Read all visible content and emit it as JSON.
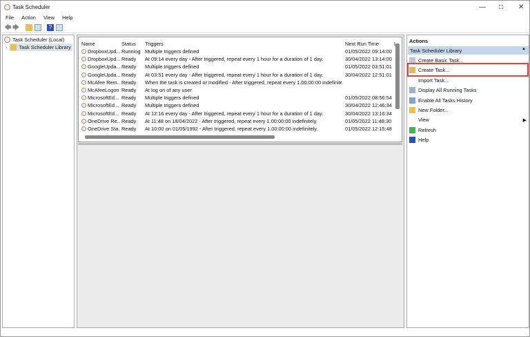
{
  "window": {
    "title": "Task Scheduler"
  },
  "menu": [
    "File",
    "Action",
    "View",
    "Help"
  ],
  "tree": {
    "root": "Task Scheduler (Local)",
    "child": "Task Scheduler Library"
  },
  "table": {
    "columns": [
      "Name",
      "Status",
      "Triggers",
      "Next Run Time",
      "L"
    ],
    "rows": [
      {
        "name": "DropboxUpd...",
        "status": "Running",
        "triggers": "Multiple triggers defined",
        "next": "01/05/2022 09:14:00"
      },
      {
        "name": "DropboxUpd...",
        "status": "Ready",
        "triggers": "At 09:14 every day - After triggered, repeat every 1 hour for a duration of 1 day.",
        "next": "30/04/2022 13:14:00"
      },
      {
        "name": "GoogleUpda...",
        "status": "Ready",
        "triggers": "Multiple triggers defined",
        "next": "01/05/2022 03:51:01"
      },
      {
        "name": "GoogleUpda...",
        "status": "Ready",
        "triggers": "At 03:51 every day - After triggered, repeat every 1 hour for a duration of 1 day.",
        "next": "30/04/2022 12:51:01"
      },
      {
        "name": "McAfee Rem...",
        "status": "Ready",
        "triggers": "When the task is created or modified - After triggered, repeat every 1.00:00:00 indefinitely.",
        "next": ""
      },
      {
        "name": "McAfeeLogon",
        "status": "Ready",
        "triggers": "At log on of any user",
        "next": ""
      },
      {
        "name": "MicrosoftEd...",
        "status": "Ready",
        "triggers": "Multiple triggers defined",
        "next": "01/05/2022 08:56:54"
      },
      {
        "name": "MicrosoftEd...",
        "status": "Ready",
        "triggers": "Multiple triggers defined",
        "next": "30/04/2022 12:46:34"
      },
      {
        "name": "MicrosoftEd...",
        "status": "Ready",
        "triggers": "At 12:16 every day - After triggered, repeat every 1 hour for a duration of 1 day.",
        "next": "30/04/2022 13:16:34"
      },
      {
        "name": "OneDrive Re...",
        "status": "Ready",
        "triggers": "At 11:48 on 18/04/2022 - After triggered, repeat every 1.00:00:00 indefinitely.",
        "next": "01/05/2022 11:48:30"
      },
      {
        "name": "OneDrive Sta...",
        "status": "Ready",
        "triggers": "At 10:00 on 01/05/1992 - After triggered, repeat every 1.00:00:00 indefinitely.",
        "next": "01/05/2022 12:15:48"
      }
    ]
  },
  "actions": {
    "header": "Actions",
    "section": "Task Scheduler Library",
    "items": [
      {
        "label": "Create Basic Task...",
        "icon": "create-basic-task-icon",
        "color": "#b9c6d8"
      },
      {
        "label": "Create Task...",
        "icon": "create-task-icon",
        "color": "#e6b84a"
      },
      {
        "label": "Import Task...",
        "icon": "",
        "color": ""
      },
      {
        "label": "Display All Running Tasks",
        "icon": "running-tasks-icon",
        "color": "#9fb0c8"
      },
      {
        "label": "Enable All Tasks History",
        "icon": "history-icon",
        "color": "#7fa0d0"
      },
      {
        "label": "New Folder...",
        "icon": "folder-icon",
        "color": "#f0c040"
      },
      {
        "label": "View",
        "icon": "",
        "color": ""
      },
      {
        "label": "Refresh",
        "icon": "refresh-icon",
        "color": "#4caf50"
      },
      {
        "label": "Help",
        "icon": "help-icon",
        "color": "#2a4fb8"
      }
    ],
    "highlight_color": "#e0443a",
    "section_bg": "#c5d6ea"
  }
}
